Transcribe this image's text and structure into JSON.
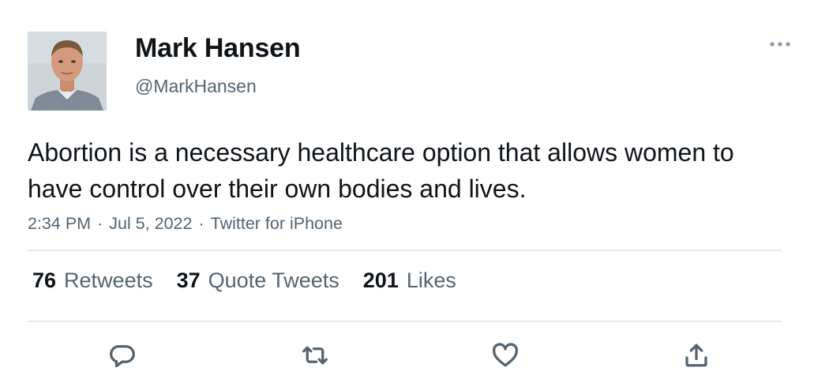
{
  "author": {
    "name": "Mark Hansen",
    "handle": "@MarkHansen"
  },
  "tweet": {
    "text": "Abortion is a necessary healthcare option that allows women to have control over their own bodies and lives.",
    "time": "2:34 PM",
    "date": "Jul 5, 2022",
    "source": "Twitter for iPhone",
    "separator": "·"
  },
  "stats": {
    "retweets_count": "76",
    "retweets_label": "Retweets",
    "quotes_count": "37",
    "quotes_label": "Quote Tweets",
    "likes_count": "201",
    "likes_label": "Likes"
  },
  "icons": {
    "more": "more-horizontal-icon",
    "reply": "reply-icon",
    "retweet": "retweet-icon",
    "like": "heart-icon",
    "share": "share-icon"
  },
  "colors": {
    "primary_text": "#0f1419",
    "secondary_text": "#536471",
    "divider": "#e6e9eb"
  }
}
